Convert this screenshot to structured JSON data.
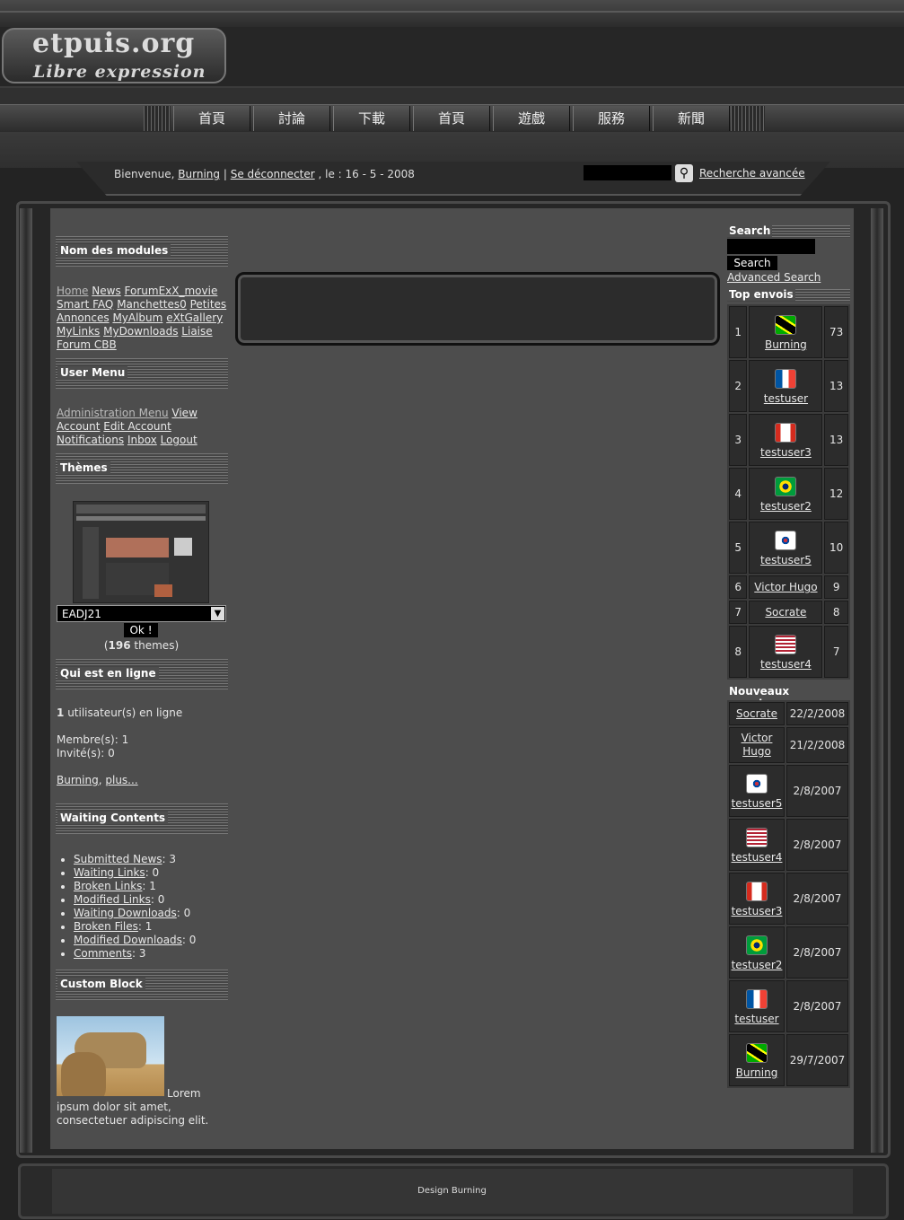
{
  "site": {
    "logo_main": "etpuis.org",
    "logo_sub": "Libre expression"
  },
  "nav": [
    "首頁",
    "討論",
    "下載",
    "首頁",
    "遊戲",
    "服務",
    "新聞"
  ],
  "welcome": {
    "prefix": "Bienvenue,",
    "user": "Burning",
    "sep": "|",
    "logout": "Se déconnecter",
    "date": ", le : 16 - 5 - 2008"
  },
  "header_search": {
    "advanced": "Recherche avancée",
    "icon": "magnifier-icon"
  },
  "left": {
    "modules_title": "Nom des modules",
    "modules": [
      "Home",
      "News",
      "ForumEx",
      "X_movie",
      "Smart FAQ",
      "Manchettes0",
      "Petites Annonces",
      "MyAlbum",
      "eXtGallery",
      "MyLinks",
      "MyDownloads",
      "Liaise",
      "Forum CBB"
    ],
    "user_menu_title": "User Menu",
    "user_menu": [
      "Administration Menu",
      "View Account",
      "Edit Account",
      "Notifications",
      "Inbox",
      "Logout"
    ],
    "themes_title": "Thèmes",
    "theme_selected": "EADJ21",
    "ok": "Ok !",
    "theme_count": "196",
    "theme_count_label": "themes",
    "online_title": "Qui est en ligne",
    "online_count": "1",
    "online_label": "utilisateur(s) en ligne",
    "members": "Membre(s): 1",
    "guests": "Invité(s): 0",
    "online_user": "Burning",
    "more": "plus...",
    "waiting_title": "Waiting Contents",
    "waiting": [
      {
        "label": "Submitted News",
        "count": ": 3"
      },
      {
        "label": "Waiting Links",
        "count": ": 0"
      },
      {
        "label": "Broken Links",
        "count": ": 1"
      },
      {
        "label": "Modified Links",
        "count": ": 0"
      },
      {
        "label": "Waiting Downloads",
        "count": ": 0"
      },
      {
        "label": "Broken Files",
        "count": ": 1"
      },
      {
        "label": "Modified Downloads",
        "count": ": 0"
      },
      {
        "label": "Comments",
        "count": ": 3"
      }
    ],
    "custom_title": "Custom Block",
    "custom_text1": "Lorem",
    "custom_text2": "ipsum dolor sit amet,",
    "custom_text3": "consectetuer adipiscing elit."
  },
  "right": {
    "search_title": "Search",
    "search_button": "Search",
    "advanced": "Advanced Search",
    "top_title": "Top envois",
    "top": [
      {
        "rank": "1",
        "name": "Burning",
        "count": "73",
        "flag": "jamaica"
      },
      {
        "rank": "2",
        "name": "testuser",
        "count": "13",
        "flag": "france"
      },
      {
        "rank": "3",
        "name": "testuser3",
        "count": "13",
        "flag": "canada"
      },
      {
        "rank": "4",
        "name": "testuser2",
        "count": "12",
        "flag": "brazil"
      },
      {
        "rank": "5",
        "name": "testuser5",
        "count": "10",
        "flag": "korea"
      },
      {
        "rank": "6",
        "name": "Victor Hugo",
        "count": "9",
        "flag": ""
      },
      {
        "rank": "7",
        "name": "Socrate",
        "count": "8",
        "flag": ""
      },
      {
        "rank": "8",
        "name": "testuser4",
        "count": "7",
        "flag": "usa"
      }
    ],
    "new_title": "Nouveaux membres",
    "new_members": [
      {
        "name": "Socrate",
        "date": "22/2/2008",
        "flag": ""
      },
      {
        "name": "Victor Hugo",
        "date": "21/2/2008",
        "flag": ""
      },
      {
        "name": "testuser5",
        "date": "2/8/2007",
        "flag": "korea"
      },
      {
        "name": "testuser4",
        "date": "2/8/2007",
        "flag": "usa"
      },
      {
        "name": "testuser3",
        "date": "2/8/2007",
        "flag": "canada"
      },
      {
        "name": "testuser2",
        "date": "2/8/2007",
        "flag": "brazil"
      },
      {
        "name": "testuser",
        "date": "2/8/2007",
        "flag": "france"
      },
      {
        "name": "Burning",
        "date": "29/7/2007",
        "flag": "jamaica"
      }
    ]
  },
  "footer": "Design Burning"
}
